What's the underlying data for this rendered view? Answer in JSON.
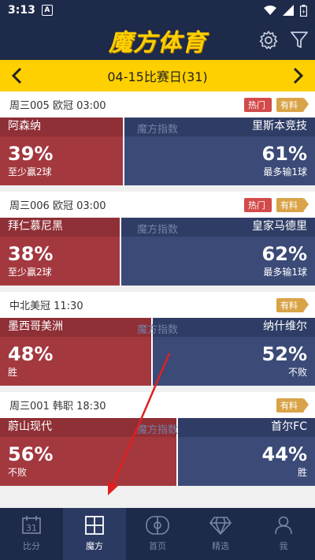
{
  "status": {
    "time": "3:13",
    "a_label": "A"
  },
  "header": {
    "logo": "魔方体育"
  },
  "datebar": {
    "title": "04-15比赛日(31)"
  },
  "center_label": "魔方指数",
  "matches": [
    {
      "head": "周三005  欧冠  03:00",
      "hot": "热门",
      "more": "有料",
      "home": "阿森纳",
      "home_pct": "39%",
      "home_sub": "至少赢2球",
      "away": "里斯本竞技",
      "away_pct": "61%",
      "away_sub": "最多输1球",
      "home_frac": 0.39
    },
    {
      "head": "周三006  欧冠  03:00",
      "hot": "热门",
      "more": "有料",
      "home": "拜仁慕尼黑",
      "home_pct": "38%",
      "home_sub": "至少赢2球",
      "away": "皇家马德里",
      "away_pct": "62%",
      "away_sub": "最多输1球",
      "home_frac": 0.38
    },
    {
      "head": "中北美冠  11:30",
      "hot": "",
      "more": "有料",
      "home": "墨西哥美洲",
      "home_pct": "48%",
      "home_sub": "胜",
      "away": "纳什维尔",
      "away_pct": "52%",
      "away_sub": "不败",
      "home_frac": 0.48
    },
    {
      "head": "周三001  韩职  18:30",
      "hot": "",
      "more": "有料",
      "home": "蔚山现代",
      "home_pct": "56%",
      "home_sub": "不败",
      "away": "首尔FC",
      "away_pct": "44%",
      "away_sub": "胜",
      "home_frac": 0.56
    }
  ],
  "nav": [
    {
      "label": "比分",
      "icon": "calendar-icon",
      "active": false
    },
    {
      "label": "魔方",
      "icon": "grid-icon",
      "active": true
    },
    {
      "label": "首页",
      "icon": "pitch-icon",
      "active": false
    },
    {
      "label": "精选",
      "icon": "diamond-icon",
      "active": false
    },
    {
      "label": "我",
      "icon": "person-icon",
      "active": false
    }
  ],
  "colors": {
    "header": "#1e2a4a",
    "accent": "#ffd000",
    "home": "#a3383f",
    "away": "#3b4a77",
    "hot": "#d24a4a",
    "more": "#d9a347"
  }
}
